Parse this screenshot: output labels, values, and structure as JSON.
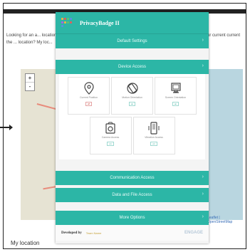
{
  "page": {
    "left_text": "Looking for an a... location on the ... location? My loc...",
    "right_text": "ur current current",
    "zoom_in": "+",
    "zoom_out": "-",
    "map_attribution": "Leaflet | OpenStreetMap",
    "bottom_text": "My location"
  },
  "popup": {
    "title": "PrivacyBadge II",
    "default_settings": "Default Settings",
    "device_access": "Device Access",
    "communication_access": "Communication Access",
    "data_file_access": "Data and File Access",
    "more_options": "More Options",
    "developed_by": "Developed by",
    "developer_name": "Team Name",
    "brand": "ENGAGE",
    "tiles": [
      {
        "label": "Current Position",
        "status": "off"
      },
      {
        "label": "Motion Orientation",
        "status": "on"
      },
      {
        "label": "Screen Orientation",
        "status": "on"
      },
      {
        "label": "Camera Access",
        "status": "on"
      },
      {
        "label": "Vibration Access",
        "status": "on"
      }
    ]
  },
  "colors": {
    "accent": "#2cb6a6",
    "status_off": "#c0392b",
    "status_on": "#27a394"
  }
}
